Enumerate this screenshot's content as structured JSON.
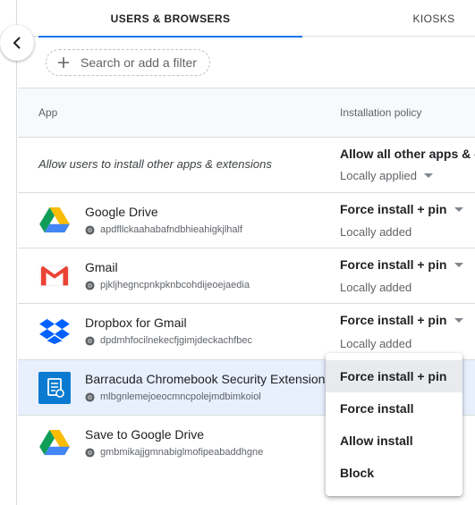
{
  "tabs": {
    "active": "USERS & BROWSERS",
    "other": "KIOSKS"
  },
  "filter": {
    "placeholder": "Search or add a filter"
  },
  "table": {
    "col_app": "App",
    "col_policy": "Installation policy"
  },
  "allow_row": {
    "label": "Allow users to install other apps & extensions",
    "policy": "Allow all other apps & extensions",
    "status": "Locally applied"
  },
  "apps": [
    {
      "name": "Google Drive",
      "id": "apdfllckaahabafndbhieahigkjlhalf",
      "policy": "Force install + pin",
      "status": "Locally added",
      "icon": "google-drive-icon"
    },
    {
      "name": "Gmail",
      "id": "pjkljhegncpnkpknbcohdijeoejaedia",
      "policy": "Force install + pin",
      "status": "Locally added",
      "icon": "gmail-icon"
    },
    {
      "name": "Dropbox for Gmail",
      "id": "dpdmhfocilnekecfjgimjdeckachfbec",
      "policy": "Force install + pin",
      "status": "Locally added",
      "icon": "dropbox-icon"
    },
    {
      "name": "Barracuda Chromebook Security Extension",
      "id": "mlbgnlemejoeocmncpolejmdbimkoiol",
      "icon": "barracuda-icon"
    },
    {
      "name": "Save to Google Drive",
      "id": "gmbmikajjgmnabiglmofipeabaddhgne",
      "icon": "google-drive-icon"
    }
  ],
  "dropdown": {
    "options": [
      "Force install + pin",
      "Force install",
      "Allow install",
      "Block"
    ],
    "selected": "Force install + pin"
  },
  "colors": {
    "accent": "#1a73e8",
    "selected_row": "#e8f0fe"
  }
}
